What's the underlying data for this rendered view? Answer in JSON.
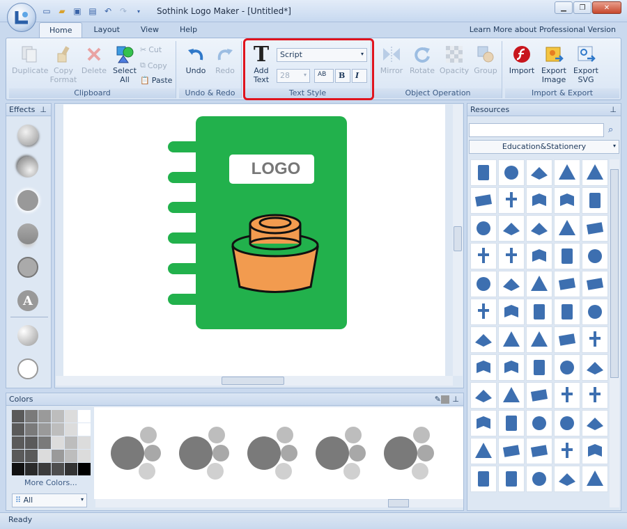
{
  "app": {
    "title": "Sothink Logo Maker - [Untitled*]",
    "learn_more": "Learn More about Professional Version"
  },
  "tabs": [
    "Home",
    "Layout",
    "View",
    "Help"
  ],
  "ribbon": {
    "clipboard": {
      "label": "Clipboard",
      "duplicate": "Duplicate",
      "copy_format_1": "Copy",
      "copy_format_2": "Format",
      "delete": "Delete",
      "select_all_1": "Select",
      "select_all_2": "All",
      "cut": "Cut",
      "copy": "Copy",
      "paste": "Paste"
    },
    "undo_redo": {
      "label": "Undo & Redo",
      "undo": "Undo",
      "redo": "Redo"
    },
    "text_style": {
      "label": "Text Style",
      "add_text_1": "Add",
      "add_text_2": "Text",
      "font": "Script",
      "size": "28",
      "bold": "B",
      "italic": "I",
      "spacing": "AB"
    },
    "object_operation": {
      "label": "Object Operation",
      "mirror": "Mirror",
      "rotate": "Rotate",
      "opacity": "Opacity",
      "group": "Group"
    },
    "import_export": {
      "label": "Import & Export",
      "import": "Import",
      "export_image_1": "Export",
      "export_image_2": "Image",
      "export_svg_1": "Export",
      "export_svg_2": "SVG"
    }
  },
  "effects": {
    "title": "Effects",
    "text_effect_letter": "A"
  },
  "canvas": {
    "logo_text": "LOGO"
  },
  "resources": {
    "title": "Resources",
    "search_placeholder": "",
    "category": "Education&Stationery"
  },
  "colors": {
    "title": "Colors",
    "more_colors": "More Colors...",
    "filter": "All"
  },
  "status": "Ready",
  "theme": {
    "accent": "#1e395b",
    "highlight": "#e0141e",
    "notebook_green": "#22b14c",
    "jar_orange": "#f29b4f",
    "icon_blue": "#3d6fb0"
  }
}
